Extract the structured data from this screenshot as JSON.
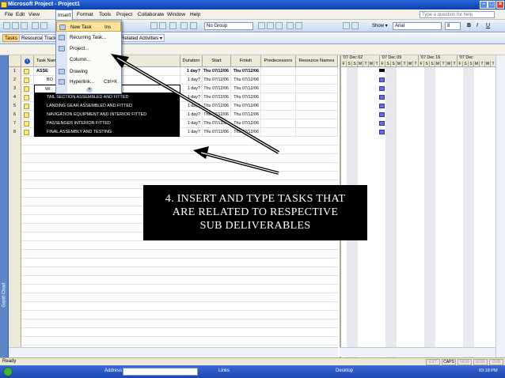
{
  "window": {
    "title": "Microsoft Project - Project1"
  },
  "menubar": {
    "items": [
      "File",
      "Edit",
      "View",
      "Insert",
      "Format",
      "Tools",
      "Project",
      "Collaborate",
      "Window",
      "Help"
    ],
    "help_placeholder": "Type a question for help"
  },
  "toolbar": {
    "group": "No Group",
    "show_label": "Show ▾",
    "font": "Arial",
    "font_size": "8",
    "bold": "B",
    "italic": "I",
    "underline": "U"
  },
  "guidebar": {
    "items": [
      "Tasks",
      "Resources",
      "Track",
      "Report"
    ],
    "related": "Related Activities ▾"
  },
  "insert_menu": {
    "items": [
      {
        "label": "New Task",
        "shortcut": "Ins"
      },
      {
        "label": "Recurring Task...",
        "shortcut": ""
      },
      {
        "label": "Project...",
        "shortcut": ""
      },
      {
        "label": "Column...",
        "shortcut": ""
      },
      {
        "label": "Drawing",
        "shortcut": ""
      },
      {
        "label": "Hyperlink...",
        "shortcut": "Ctrl+K"
      }
    ],
    "more": "»"
  },
  "grid": {
    "columns": [
      "",
      "",
      "Task Name",
      "Duration",
      "Start",
      "Finish",
      "Predecessors",
      "Resource Names"
    ],
    "rows": [
      {
        "id": "1",
        "name": "ASSE",
        "duration": "1 day?",
        "start": "Thu 07/12/06",
        "finish": "Thu 07/12/06",
        "style": "summary"
      },
      {
        "id": "2",
        "name": "BO",
        "duration": "1 day?",
        "start": "Thu 07/12/06",
        "finish": "Thu 07/12/06",
        "style": "normal"
      },
      {
        "id": "3",
        "name": "WI",
        "duration": "1 day?",
        "start": "Thu 07/12/06",
        "finish": "Thu 07/12/06",
        "style": "editing"
      },
      {
        "id": "4",
        "name": "TAIL SECTION ASSEMBLED AND FITTED",
        "duration": "1 day?",
        "start": "Thu 07/12/06",
        "finish": "Thu 07/12/06",
        "style": "selected"
      },
      {
        "id": "5",
        "name": "LANDING GEAR ASSEMBLED AND FITTED",
        "duration": "1 day?",
        "start": "Thu 07/12/06",
        "finish": "Thu 07/12/06",
        "style": "selected"
      },
      {
        "id": "6",
        "name": "NAVIGATION EQUIPMENT AND INTERIOR FITTED",
        "duration": "1 day?",
        "start": "Thu 07/12/06",
        "finish": "Thu 07/12/06",
        "style": "selected"
      },
      {
        "id": "7",
        "name": "PASSENGER INTERIOR FITTED",
        "duration": "1 day?",
        "start": "Thu 07/12/06",
        "finish": "Thu 07/12/06",
        "style": "selected"
      },
      {
        "id": "8",
        "name": "FINAL ASSEMBLY AND TESTING",
        "duration": "1 day?",
        "start": "Thu 07/12/06",
        "finish": "Thu 07/12/06",
        "style": "selected"
      }
    ]
  },
  "gantt": {
    "weeks": [
      "'07 Dec 02",
      "'07 Dec 09",
      "'07 Dec 16",
      "'07 Dec"
    ],
    "days": [
      "F",
      "S",
      "S",
      "M",
      "T",
      "W",
      "T",
      "F",
      "S",
      "S",
      "M",
      "T",
      "W",
      "T",
      "F",
      "S",
      "S",
      "M",
      "T",
      "W",
      "T",
      "F",
      "S",
      "S",
      "M",
      "T",
      "W",
      "T"
    ]
  },
  "viewbar": {
    "label": "Gantt Chart"
  },
  "status": {
    "text": "Ready",
    "indicators": [
      "EXT",
      "CAPS",
      "NUM",
      "SCRL",
      "OVR"
    ],
    "active": "CAPS"
  },
  "taskbar": {
    "address": "Address",
    "links": "Links",
    "desktop": "Desktop",
    "clock": "03:18 PM"
  },
  "callout": {
    "lines": [
      "4. INSERT AND TYPE TASKS THAT",
      "ARE RELATED TO RESPECTIVE",
      "SUB DELIVERABLES"
    ]
  }
}
